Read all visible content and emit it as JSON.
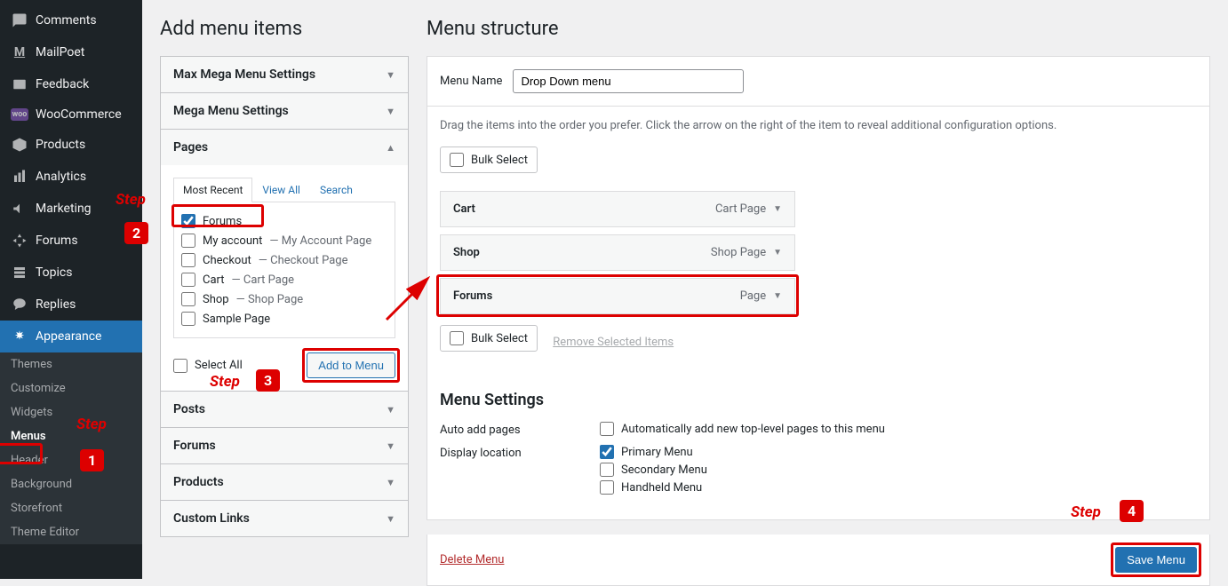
{
  "sidebar": {
    "items": [
      {
        "label": "Comments",
        "icon": "comment"
      },
      {
        "label": "MailPoet",
        "icon": "M"
      },
      {
        "label": "Feedback",
        "icon": "feedback"
      },
      {
        "label": "WooCommerce",
        "icon": "woo"
      },
      {
        "label": "Products",
        "icon": "product"
      },
      {
        "label": "Analytics",
        "icon": "analytics"
      },
      {
        "label": "Marketing",
        "icon": "marketing"
      },
      {
        "label": "Forums",
        "icon": "forums"
      },
      {
        "label": "Topics",
        "icon": "topics"
      },
      {
        "label": "Replies",
        "icon": "replies"
      },
      {
        "label": "Appearance",
        "icon": "appearance",
        "active": true
      }
    ],
    "subitems": [
      {
        "label": "Themes"
      },
      {
        "label": "Customize"
      },
      {
        "label": "Widgets"
      },
      {
        "label": "Menus",
        "active": true
      },
      {
        "label": "Header"
      },
      {
        "label": "Background"
      },
      {
        "label": "Storefront"
      },
      {
        "label": "Theme Editor"
      }
    ]
  },
  "left": {
    "title": "Add menu items",
    "accordions": [
      {
        "label": "Max Mega Menu Settings"
      },
      {
        "label": "Mega Menu Settings"
      },
      {
        "label": "Pages",
        "open": true
      },
      {
        "label": "Posts"
      },
      {
        "label": "Forums"
      },
      {
        "label": "Products"
      },
      {
        "label": "Custom Links"
      }
    ],
    "tabs": [
      {
        "label": "Most Recent",
        "active": true
      },
      {
        "label": "View All"
      },
      {
        "label": "Search"
      }
    ],
    "pages": [
      {
        "name": "Forums",
        "suffix": "",
        "checked": true
      },
      {
        "name": "My account",
        "suffix": " — My Account Page"
      },
      {
        "name": "Checkout",
        "suffix": " — Checkout Page"
      },
      {
        "name": "Cart",
        "suffix": " — Cart Page"
      },
      {
        "name": "Shop",
        "suffix": " — Shop Page"
      },
      {
        "name": "Sample Page",
        "suffix": ""
      }
    ],
    "select_all": "Select All",
    "add_button": "Add to Menu"
  },
  "right": {
    "title": "Menu structure",
    "menu_name_label": "Menu Name",
    "menu_name_value": "Drop Down menu",
    "hint": "Drag the items into the order you prefer. Click the arrow on the right of the item to reveal additional configuration options.",
    "bulk_select": "Bulk Select",
    "remove_selected": "Remove Selected Items",
    "items": [
      {
        "label": "Cart",
        "type": "Cart Page"
      },
      {
        "label": "Shop",
        "type": "Shop Page"
      },
      {
        "label": "Forums",
        "type": "Page",
        "highlighted": true
      }
    ],
    "settings_title": "Menu Settings",
    "auto_add_label": "Auto add pages",
    "auto_add_check": "Automatically add new top-level pages to this menu",
    "display_loc_label": "Display location",
    "locations": [
      {
        "label": "Primary Menu",
        "checked": true
      },
      {
        "label": "Secondary Menu"
      },
      {
        "label": "Handheld Menu"
      }
    ],
    "delete_menu": "Delete Menu",
    "save_menu": "Save Menu"
  },
  "annotations": {
    "step_label": "Step"
  }
}
